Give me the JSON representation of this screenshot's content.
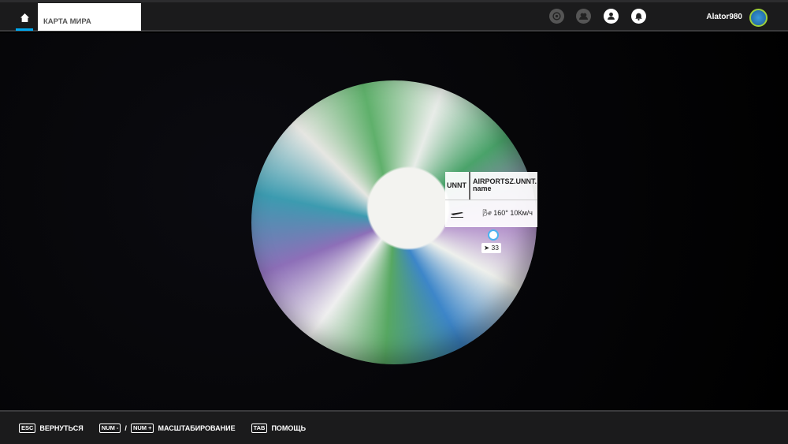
{
  "topbar": {
    "tab_label": "КАРТА МИРА",
    "username": "Alator980",
    "accent": "#00a8ef",
    "icons": [
      "home-icon",
      "radar-icon",
      "friends-icon",
      "profile-icon",
      "bell-icon"
    ]
  },
  "popup": {
    "code": "UNNT",
    "name": "AIRPORTSZ.UNNT.\nname",
    "wind": "160° 10Км/ч"
  },
  "marker": {
    "count": "33"
  },
  "footer": {
    "esc_key": "ESC",
    "back": "ВЕРНУТЬСЯ",
    "num_minus": "NUM -",
    "slash": "/",
    "num_plus": "NUM +",
    "zoom": "МАСШТАБИРОВАНИЕ",
    "tab_key": "TAB",
    "help": "ПОМОЩЬ"
  }
}
